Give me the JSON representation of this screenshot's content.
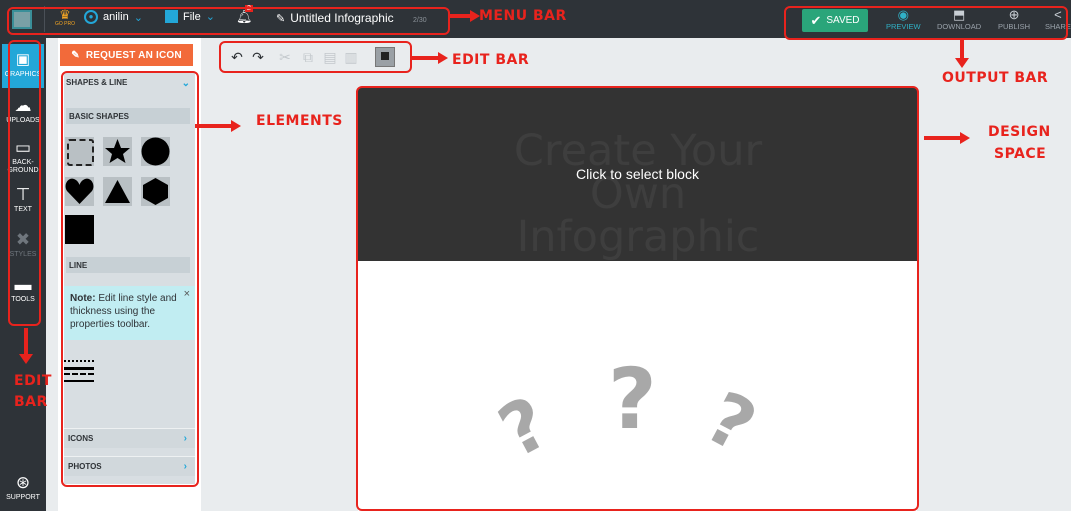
{
  "menu": {
    "user_name": "anilin",
    "gopro_label": "GO PRO",
    "file_label": "File",
    "notification_count": "2",
    "doc_title": "Untitled Infographic",
    "page_counter": "2/30"
  },
  "output": {
    "saved_label": "SAVED",
    "preview_label": "PREVIEW",
    "download_label": "DOWNLOAD",
    "publish_label": "PUBLISH",
    "share_label": "SHARE"
  },
  "sidebar": {
    "items": [
      {
        "label": "GRAPHICS",
        "icon": "image-icon"
      },
      {
        "label": "UPLOADS",
        "icon": "cloud-upload-icon"
      },
      {
        "label": "BACK-\nGROUND",
        "icon": "monitor-icon"
      },
      {
        "label": "TEXT",
        "icon": "text-icon"
      },
      {
        "label": "STYLES",
        "icon": "styles-icon"
      },
      {
        "label": "TOOLS",
        "icon": "tools-icon"
      },
      {
        "label": "SUPPORT",
        "icon": "lifebuoy-icon"
      }
    ],
    "back_ground_line1": "BACK-",
    "back_ground_line2": "GROUND"
  },
  "panel": {
    "request_icon_label": "REQUEST AN ICON",
    "shapes_line_label": "SHAPES & LINE",
    "basic_shapes_label": "BASIC SHAPES",
    "line_label": "LINE",
    "note_bold": "Note:",
    "note_text": " Edit line style and thickness using the properties toolbar.",
    "icons_label": "ICONS",
    "photos_label": "PHOTOS"
  },
  "design": {
    "title_text": "Create Your Own Infographic",
    "click_label": "Click to select block"
  },
  "annotations": {
    "menu_bar": "MENU BAR",
    "edit_bar_top": "EDIT BAR",
    "output_bar": "OUTPUT BAR",
    "elements": "ELEMENTS",
    "design": "DESIGN",
    "space": "SPACE",
    "edit": "EDIT",
    "bar": "BAR"
  },
  "colors": {
    "topbar": "#2e3338",
    "accent_blue": "#23a7d8",
    "saved_green": "#2aa57a",
    "request_orange": "#f26a3a",
    "annotation_red": "#e8231d"
  }
}
